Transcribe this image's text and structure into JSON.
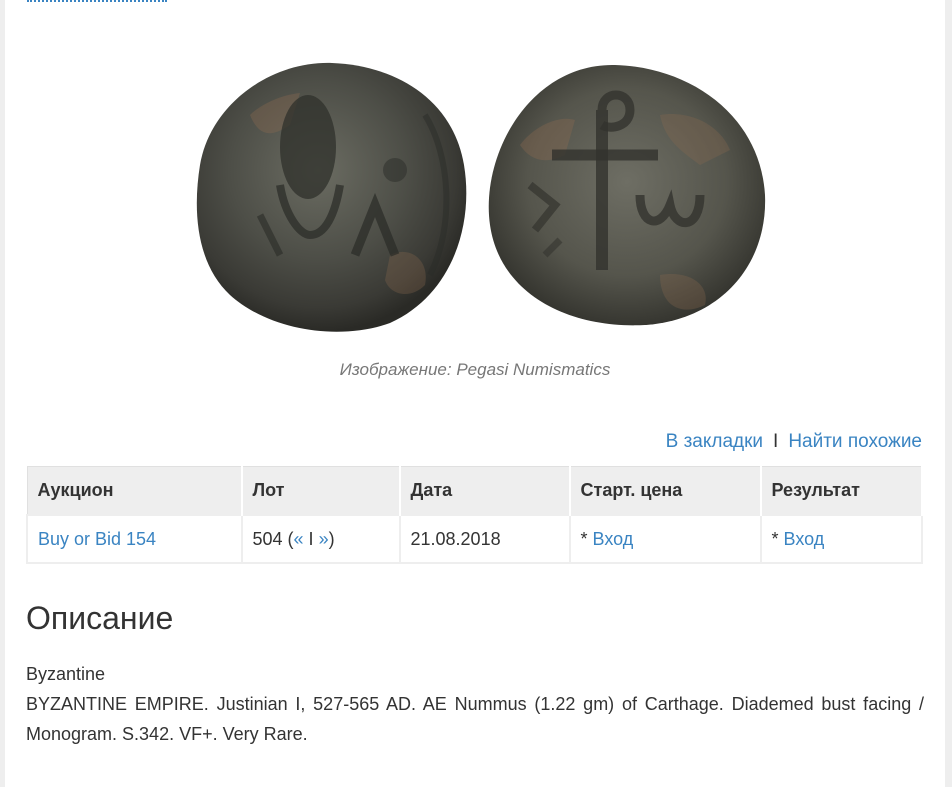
{
  "image": {
    "caption_prefix": "Изображение:",
    "caption_source": "Pegasi Numismatics"
  },
  "actions": {
    "bookmark": "В закладки",
    "separator": "I",
    "similar": "Найти похожие"
  },
  "table": {
    "headers": [
      "Аукцион",
      "Лот",
      "Дата",
      "Старт. цена",
      "Результат"
    ],
    "row": {
      "auction": "Buy or Bid 154",
      "lot_number": "504 (",
      "lot_prev": "«",
      "lot_sep": " I ",
      "lot_next": "»",
      "lot_close": ")",
      "date": "21.08.2018",
      "start_prefix": "* ",
      "start_link": "Вход",
      "result_prefix": "* ",
      "result_link": "Вход"
    }
  },
  "description": {
    "title": "Описание",
    "category": "Byzantine",
    "text": "BYZANTINE EMPIRE. Justinian I, 527-565 AD. AE Nummus (1.22 gm) of Carthage. Diademed bust facing / Monogram. S.342. VF+. Very Rare."
  },
  "colors": {
    "link": "#3a84c2",
    "text": "#333333",
    "header_bg": "#eeeeee",
    "caption": "#777777"
  }
}
